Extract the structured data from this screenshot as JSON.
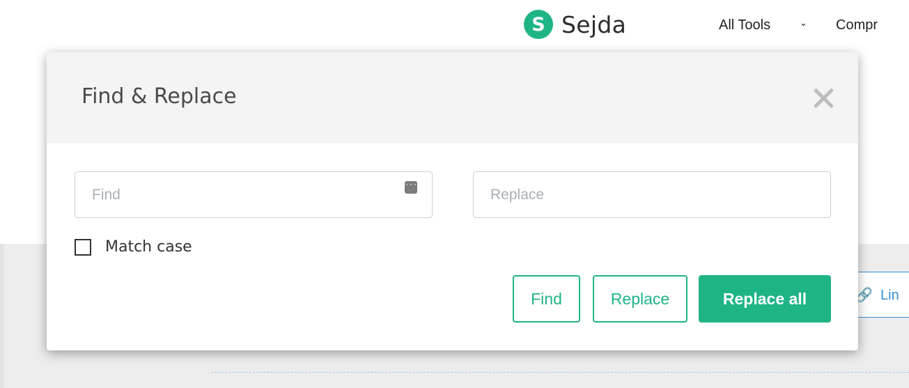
{
  "header": {
    "logo_letter": "S",
    "logo_text": "Sejda",
    "nav_all_tools": "All Tools",
    "nav_chevron": "⌄",
    "nav_compress": "Compr"
  },
  "background": {
    "link_icon": "🔗",
    "link_label": "Lin"
  },
  "dialog": {
    "title": "Find & Replace",
    "find_placeholder": "Find",
    "find_value": "",
    "replace_placeholder": "Replace",
    "replace_value": "",
    "kbd_icon_glyph": "···",
    "match_case_label": "Match case",
    "match_case_checked": false,
    "buttons": {
      "find": "Find",
      "replace": "Replace",
      "replace_all": "Replace all"
    }
  },
  "colors": {
    "brand_green": "#1fb486",
    "link_blue": "#2f8fd8"
  },
  "icons": [
    "sejda-logo-icon",
    "chevron-down-icon",
    "close-icon",
    "keyboard-icon",
    "link-icon",
    "checkbox-icon"
  ]
}
